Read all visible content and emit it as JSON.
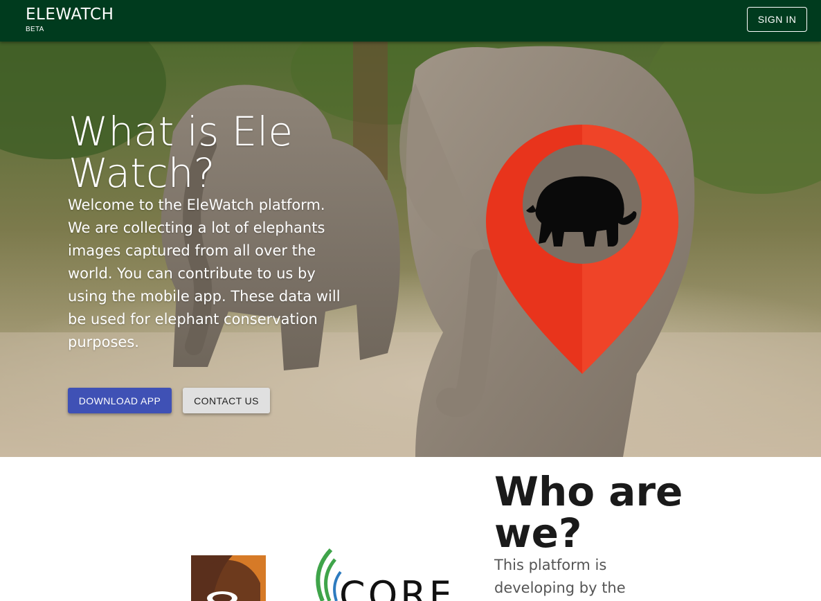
{
  "appbar": {
    "title": "ELEWATCH",
    "subtitle": "BETA",
    "signin_label": "SIGN IN"
  },
  "hero": {
    "title": "What is Ele Watch?",
    "description": "Welcome to the EleWatch platform. We are collecting a lot of elephants images captured from all over the world. You can contribute to us by using the mobile app. These data will be used for elephant conservation purposes.",
    "download_label": "DOWNLOAD APP",
    "contact_label": "CONTACT US"
  },
  "who": {
    "title": "Who are we?",
    "description": "This platform is developing by the"
  },
  "logos": {
    "partner2_text": "CORE"
  },
  "colors": {
    "appbar_bg": "#003b1e",
    "primary_button": "#3f51b5",
    "secondary_button": "#e0e0e0",
    "pin_red": "#e8341c"
  },
  "icons": {
    "pin": "map-pin-icon",
    "elephant": "elephant-icon"
  }
}
